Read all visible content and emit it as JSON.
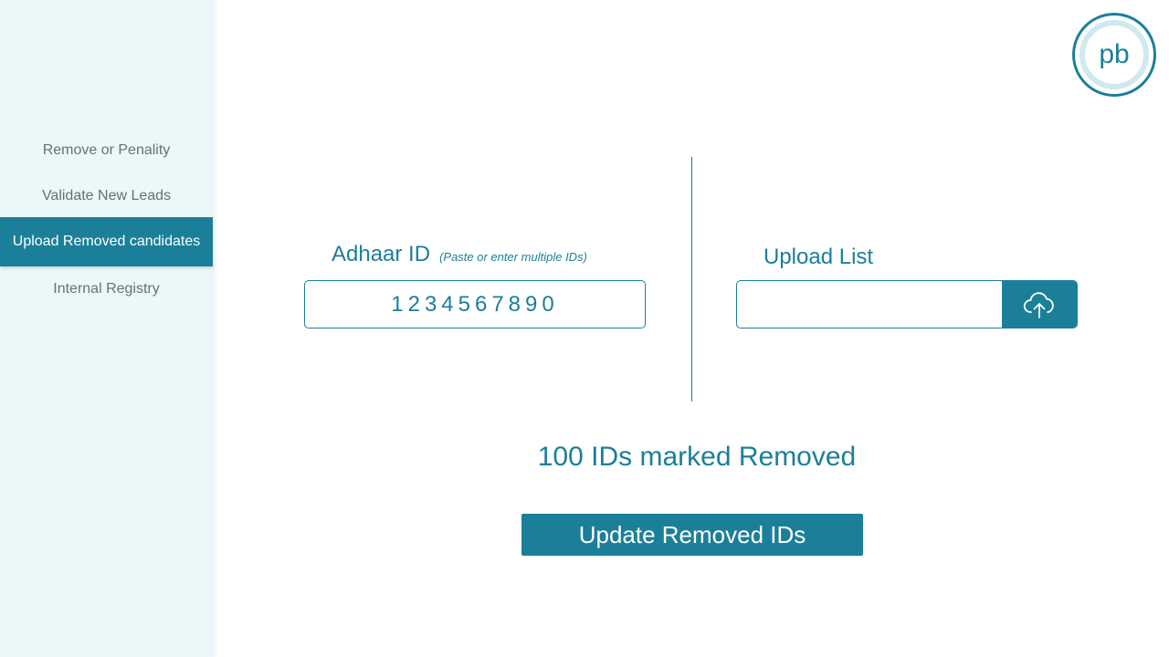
{
  "sidebar": {
    "items": [
      {
        "label": "Remove or Penality",
        "active": false
      },
      {
        "label": "Validate New Leads",
        "active": false
      },
      {
        "label": "Upload Removed candidates",
        "active": true
      },
      {
        "label": "Internal Registry",
        "active": false
      }
    ]
  },
  "logo": {
    "text": "pb"
  },
  "adhaar": {
    "label": "Adhaar ID",
    "hint": "(Paste or enter multiple IDs)",
    "value": "1234567890"
  },
  "upload": {
    "label": "Upload List",
    "icon": "cloud-upload-icon"
  },
  "status": {
    "text": "100 IDs marked Removed"
  },
  "actions": {
    "update_label": "Update Removed IDs"
  },
  "colors": {
    "accent": "#1b7f99",
    "sidebar_bg": "#eaf8f9",
    "logo_inner": "#cfe9ef"
  }
}
